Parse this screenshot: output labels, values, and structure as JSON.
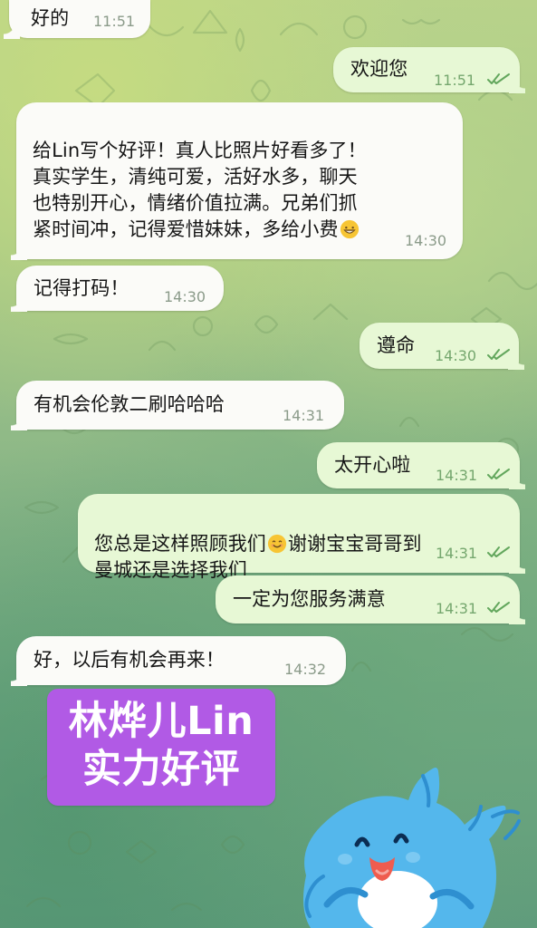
{
  "colors": {
    "incoming_bubble": "#fbfbf8",
    "outgoing_bubble": "#e7f8d5",
    "outgoing_timestamp": "#75a76e",
    "incoming_timestamp": "#8b9b8a",
    "promo_background": "#b15ae5"
  },
  "chat": {
    "messages": [
      {
        "direction": "incoming",
        "text": "好的",
        "time": "11:51"
      },
      {
        "direction": "outgoing",
        "text": "欢迎您",
        "time": "11:51",
        "status": "double-check-icon"
      },
      {
        "direction": "incoming",
        "text_before_emoji": "给Lin写个好评！真人比照片好看多了！\n真实学生，清纯可爱，活好水多，聊天\n也特别开心，情绪价值拉满。兄弟们抓\n紧时间冲，记得爱惜妹妹，多给小费",
        "emoji": "grinning-face-icon",
        "time": "14:30"
      },
      {
        "direction": "incoming",
        "text": "记得打码！",
        "time": "14:30"
      },
      {
        "direction": "outgoing",
        "text": "遵命",
        "time": "14:30",
        "status": "double-check-icon"
      },
      {
        "direction": "incoming",
        "text": "有机会伦敦二刷哈哈哈",
        "time": "14:31"
      },
      {
        "direction": "outgoing",
        "text": "太开心啦",
        "time": "14:31",
        "status": "double-check-icon"
      },
      {
        "direction": "outgoing",
        "text_before_emoji": "您总是这样照顾我们",
        "emoji": "smiling-face-icon",
        "text_after_emoji": "谢谢宝宝哥哥到\n曼城还是选择我们",
        "time": "14:31",
        "status": "double-check-icon"
      },
      {
        "direction": "outgoing",
        "text": "一定为您服务满意",
        "time": "14:31",
        "status": "double-check-icon"
      },
      {
        "direction": "incoming",
        "text": "好，以后有机会再来！",
        "time": "14:32"
      }
    ]
  },
  "promo_badge": {
    "line1": "林烨儿Lin",
    "line2": "实力好评"
  },
  "sticker": {
    "icon": "blue-cat-sticker-icon"
  }
}
